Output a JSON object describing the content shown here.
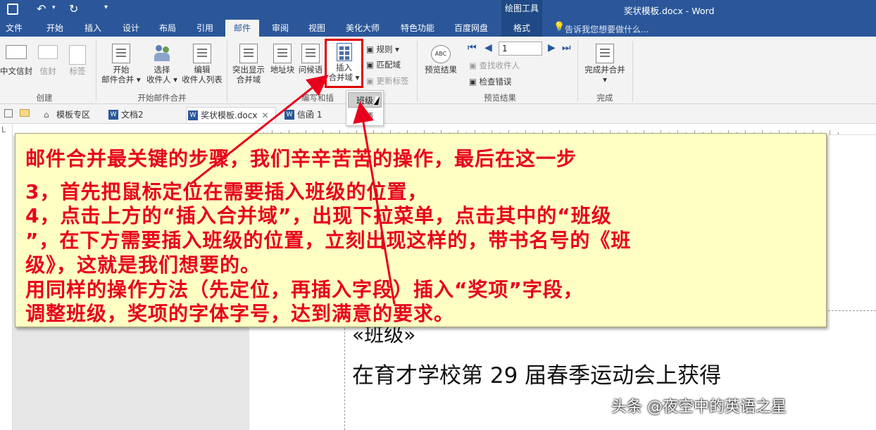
{
  "title_bar": {
    "tool_group": "绘图工具",
    "doc_title": "奖状模板.docx - Word"
  },
  "tabs": [
    "文件",
    "开始",
    "插入",
    "设计",
    "布局",
    "引用",
    "邮件",
    "审阅",
    "视图",
    "美化大师",
    "特色功能",
    "百度网盘",
    "格式"
  ],
  "tell_me": "告诉我您想要做什么...",
  "ribbon": {
    "create": {
      "label": "创建",
      "zh_envelope": "中文信封",
      "envelope": "信封",
      "labels": "标签"
    },
    "start": {
      "label": "开始邮件合并",
      "start_merge": "开始\n邮件合并",
      "select_recipients": "选择\n收件人",
      "edit_list": "编辑\n收件人列表"
    },
    "write": {
      "label": "编写和插",
      "highlight": "突出显示\n合并域",
      "address": "地址块",
      "greeting": "问候语",
      "insert_field": "插入\n合并域",
      "rules": "规则",
      "match": "匹配域",
      "update": "更新标签"
    },
    "preview": {
      "label": "预览结果",
      "preview_btn": "预览结果",
      "record": "1",
      "find": "查找收件人",
      "check": "检查错误"
    },
    "finish": {
      "label": "完成",
      "finish_merge": "完成并合并"
    }
  },
  "dropdown": [
    "班级",
    "奖项"
  ],
  "doc_tabs": [
    "模板专区",
    "文档2",
    "奖状模板.docx",
    "信函 1"
  ],
  "doc": {
    "field": "«班级»",
    "line": "在育才学校第 29 届春季运动会上获得"
  },
  "note_lines": [
    "邮件合并最关键的步骤，我们辛辛苦苦的操作，最后在这一步",
    "3，首先把鼠标定位在需要插入班级的位置，",
    "4，点击上方的“插入合并域”，出现下拉菜单，点击其中的“班级",
    "”，在下方需要插入班级的位置，立刻出现这样的，带书名号的《班",
    "级》，这就是我们想要的。",
    "用同样的操作方法（先定位，再插入字段）插入“奖项”字段，",
    "调整班级，奖项的字体字号，达到满意的要求。"
  ],
  "watermark": "头条 @夜空中的英语之星",
  "colors": {
    "word_blue": "#2b579a",
    "annotation_red": "#e8001c",
    "note_bg": "#ffffc4"
  }
}
